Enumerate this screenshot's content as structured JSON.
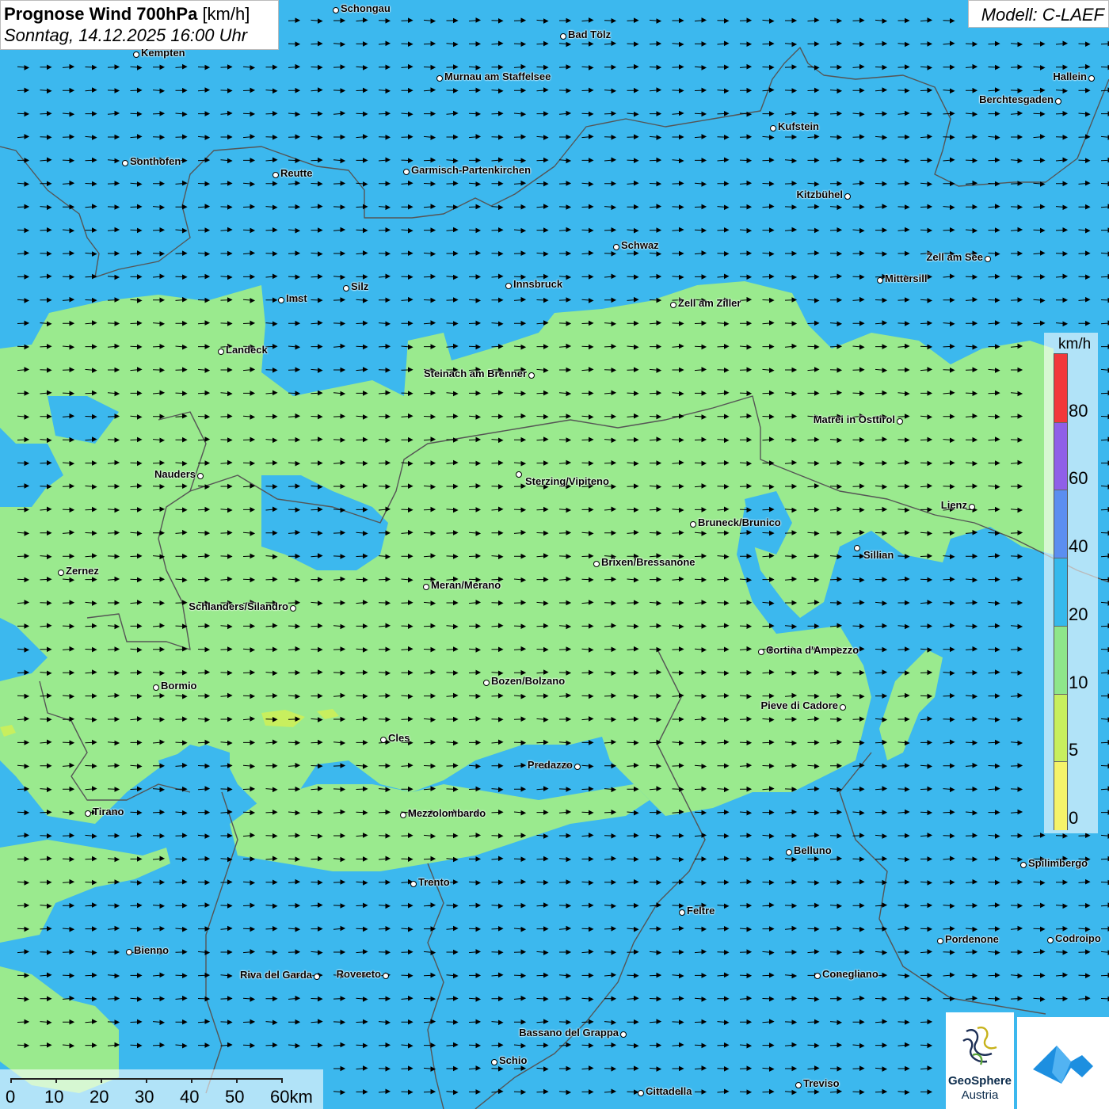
{
  "header": {
    "title_bold": "Prognose Wind 700hPa",
    "title_unit": "[km/h]",
    "datetime": "Sonntag, 14.12.2025 16:00 Uhr",
    "model": "Modell: C-LAEF"
  },
  "legend": {
    "unit": "km/h",
    "labels": [
      "80",
      "60",
      "40",
      "20",
      "10",
      "5",
      "0"
    ],
    "bands": [
      {
        "color": "#f2383a"
      },
      {
        "color": "#8f5fe8"
      },
      {
        "color": "#5b8ef0"
      },
      {
        "color": "#35b9ec"
      },
      {
        "color": "#8ee68a"
      },
      {
        "color": "#c8ef5e"
      },
      {
        "color": "#f5f36a"
      }
    ]
  },
  "scale_bar": {
    "labels": [
      "0",
      "10",
      "20",
      "30",
      "40",
      "50",
      "60km"
    ]
  },
  "logos": {
    "geosphere_line1": "GeoSphere",
    "geosphere_line2": "Austria",
    "app_icon": "warn-app-icon"
  },
  "colors": {
    "sea_blue": "#3cb8ee",
    "land_green": "#9aea8e",
    "border": "#555555",
    "arrow": "#000000"
  },
  "wind": {
    "direction": "east"
  },
  "cities": [
    {
      "name": "Schongau"
    },
    {
      "name": "Bad Tölz"
    },
    {
      "name": "Kempten"
    },
    {
      "name": "Murnau am Staffelsee"
    },
    {
      "name": "Hallein"
    },
    {
      "name": "Berchtesgaden"
    },
    {
      "name": "Kufstein"
    },
    {
      "name": "Sonthofen"
    },
    {
      "name": "Reutte"
    },
    {
      "name": "Garmisch-Partenkirchen"
    },
    {
      "name": "Kitzbühel"
    },
    {
      "name": "Schwaz"
    },
    {
      "name": "Zell am See"
    },
    {
      "name": "Mittersill"
    },
    {
      "name": "Silz"
    },
    {
      "name": "Innsbruck"
    },
    {
      "name": "Imst"
    },
    {
      "name": "Zell am Ziller"
    },
    {
      "name": "Landeck"
    },
    {
      "name": "Steinach am Brenner"
    },
    {
      "name": "Matrei in Osttirol"
    },
    {
      "name": "Nauders"
    },
    {
      "name": "Sterzing/Vipiteno"
    },
    {
      "name": "Lienz"
    },
    {
      "name": "Bruneck/Brunico"
    },
    {
      "name": "Sillian"
    },
    {
      "name": "Brixen/Bressanone"
    },
    {
      "name": "Zernez"
    },
    {
      "name": "Meran/Merano"
    },
    {
      "name": "Schlanders/Silandro"
    },
    {
      "name": "Cortina d'Ampezzo"
    },
    {
      "name": "Bozen/Bolzano"
    },
    {
      "name": "Bormio"
    },
    {
      "name": "Pieve di Cadore"
    },
    {
      "name": "Cles"
    },
    {
      "name": "Predazzo"
    },
    {
      "name": "Tirano"
    },
    {
      "name": "Mezzolombardo"
    },
    {
      "name": "Belluno"
    },
    {
      "name": "Spilimbergo"
    },
    {
      "name": "Trento"
    },
    {
      "name": "Feltre"
    },
    {
      "name": "Pordenone"
    },
    {
      "name": "Codroipo"
    },
    {
      "name": "Bienno"
    },
    {
      "name": "Riva del Garda"
    },
    {
      "name": "Rovereto"
    },
    {
      "name": "Conegliano"
    },
    {
      "name": "Bassano del Grappa"
    },
    {
      "name": "Schio"
    },
    {
      "name": "Treviso"
    },
    {
      "name": "Cittadella"
    }
  ]
}
